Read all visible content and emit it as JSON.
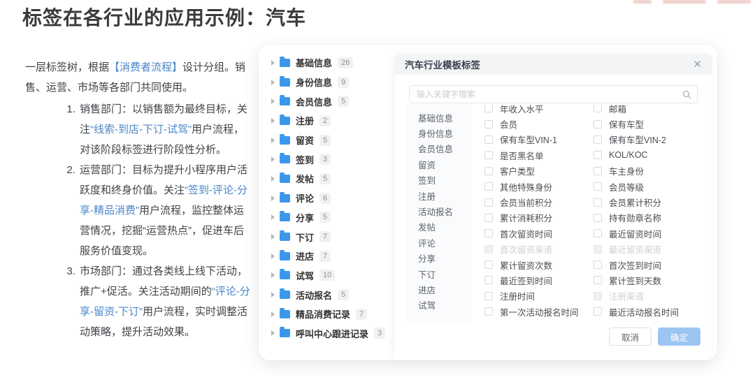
{
  "page": {
    "title": "标签在各行业的应用示例：汽车"
  },
  "left_panel": {
    "intro_segments": [
      {
        "t": "一层标签树，根据"
      },
      {
        "t": "【消费者流程】",
        "blue": true
      },
      {
        "t": "设计分组。销售、运营、市场等各部门共同使用。"
      }
    ],
    "list": [
      {
        "segments": [
          {
            "t": "销售部门：以销售额为最终目标，关注"
          },
          {
            "t": "“线索-到店-下订-试驾”",
            "blue": true
          },
          {
            "t": "用户流程，对该阶段标签进行阶段性分析。"
          }
        ]
      },
      {
        "segments": [
          {
            "t": "运营部门：目标为提升小程序用户活跃度和终身价值。关注"
          },
          {
            "t": "“签到-评论-分享-精品消费”",
            "blue": true
          },
          {
            "t": "用户流程，监控整体运营情况，挖掘“运营热点”，促进车后服务价值变现。"
          }
        ]
      },
      {
        "segments": [
          {
            "t": "市场部门：通过各类线上线下活动，推广+促活。关注活动期间的"
          },
          {
            "t": "“评论-分享-留资-下订”",
            "blue": true
          },
          {
            "t": "用户流程，实时调整活动策略，提升活动效果。"
          }
        ]
      }
    ]
  },
  "tree": {
    "items": [
      {
        "label": "基础信息",
        "count": "26"
      },
      {
        "label": "身份信息",
        "count": "9"
      },
      {
        "label": "会员信息",
        "count": "5"
      },
      {
        "label": "注册",
        "count": "2"
      },
      {
        "label": "留资",
        "count": "5"
      },
      {
        "label": "签到",
        "count": "3"
      },
      {
        "label": "发帖",
        "count": "5"
      },
      {
        "label": "评论",
        "count": "6"
      },
      {
        "label": "分享",
        "count": "5"
      },
      {
        "label": "下订",
        "count": "7"
      },
      {
        "label": "进店",
        "count": "7"
      },
      {
        "label": "试驾",
        "count": "10"
      },
      {
        "label": "活动报名",
        "count": "5"
      },
      {
        "label": "精品消费记录",
        "count": "7"
      },
      {
        "label": "呼叫中心跟进记录",
        "count": "3"
      }
    ]
  },
  "modal": {
    "title": "汽车行业模板标签",
    "close_label": "✕",
    "search": {
      "placeholder": "输入关键字搜索"
    },
    "categories": [
      "基础信息",
      "身份信息",
      "会员信息",
      "留资",
      "签到",
      "注册",
      "活动报名",
      "发帖",
      "评论",
      "分享",
      "下订",
      "进店",
      "试驾"
    ],
    "tags_left": [
      {
        "label": "年收入水平"
      },
      {
        "label": "会员"
      },
      {
        "label": "保有车型VIN-1"
      },
      {
        "label": "是否黑名单"
      },
      {
        "label": "客户类型"
      },
      {
        "label": "其他特殊身份"
      },
      {
        "label": "会员当前积分"
      },
      {
        "label": "累计消耗积分"
      },
      {
        "label": "首次留资时间"
      },
      {
        "label": "首次留资渠道",
        "disabled": true
      },
      {
        "label": "累计留资次数"
      },
      {
        "label": "最近签到时间"
      },
      {
        "label": "注册时间"
      },
      {
        "label": "第一次活动报名时间"
      }
    ],
    "tags_right": [
      {
        "label": "邮箱"
      },
      {
        "label": "保有车型"
      },
      {
        "label": "保有车型VIN-2"
      },
      {
        "label": "KOL/KOC"
      },
      {
        "label": "车主身份"
      },
      {
        "label": "会员等级"
      },
      {
        "label": "会员累计积分"
      },
      {
        "label": "持有勋章名称"
      },
      {
        "label": "最近留资时间"
      },
      {
        "label": "最近留资渠道",
        "disabled": true
      },
      {
        "label": "首次签到时间"
      },
      {
        "label": "累计签到天数"
      },
      {
        "label": "注册渠道",
        "disabled": true
      },
      {
        "label": "最近活动报名时间"
      }
    ],
    "footer": {
      "cancel": "取消",
      "confirm": "确定"
    }
  },
  "colors": {
    "accent_blue": "#3b97ec",
    "link_blue": "#4a86c8",
    "confirm_button_bg": "#9dc5f1"
  }
}
